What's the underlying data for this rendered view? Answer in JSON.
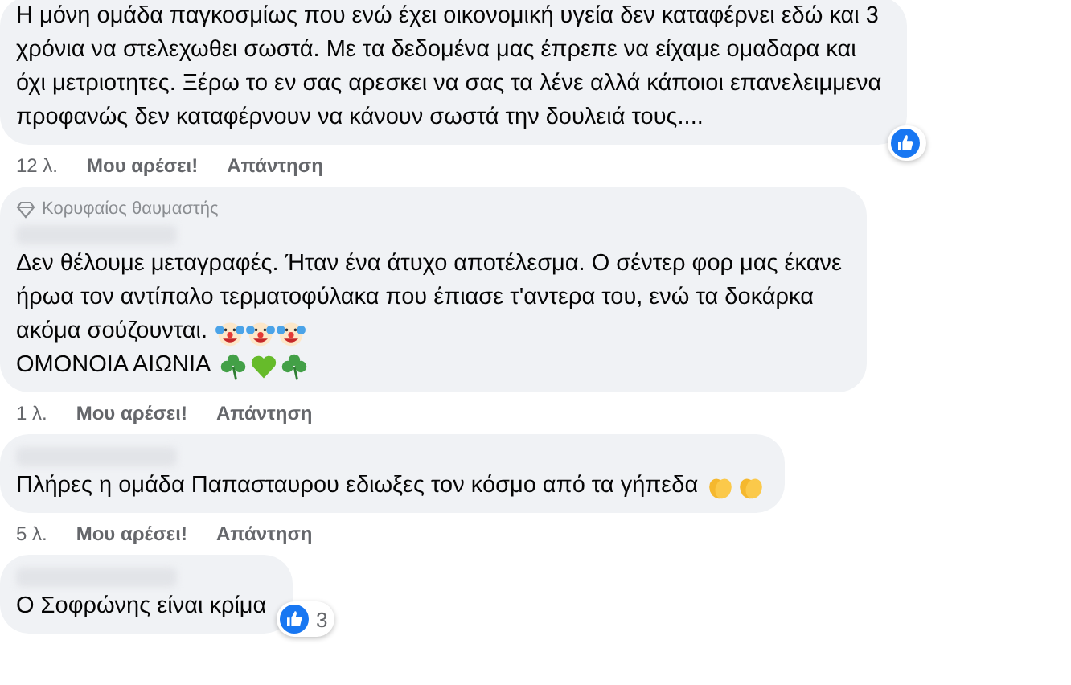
{
  "comments": [
    {
      "lines": [
        {
          "text": "Η μόνη ομάδα παγκοσμίως που ενώ έχει οικονομική υγεία δεν καταφέρνει εδώ και 3"
        },
        {
          "text": "χρόνια να στελεχωθει σωστά. Με τα δεδομένα μας έπρεπε να είχαμε ομαδαρα και"
        },
        {
          "text": "όχι μετριοτητες. Ξέρω το εν σας αρεσκει να σας τα λένε αλλά κάποιοι επανελειμμενα"
        },
        {
          "text": "προφανώς δεν καταφέρνουν να κάνουν σωστά την δουλειά τους...."
        }
      ],
      "reaction": {
        "kind": "like"
      },
      "time": "12 λ.",
      "like": "Μου αρέσει!",
      "reply": "Απάντηση"
    },
    {
      "badge": "Κορυφαίος θαυμαστής",
      "lines": [
        {
          "text": "Δεν θέλουμε μεταγραφές. Ήταν ένα άτυχο αποτέλεσμα. Ο σέντερ φορ μας έκανε"
        },
        {
          "text": "ήρωα τον αντίπαλο τερματοφύλακα που έπιασε τ'αντερα του, ενώ τα δοκάρκα"
        },
        {
          "text": "ακόμα σούζουνται.",
          "emojis": [
            {
              "kind": "clown"
            },
            {
              "kind": "clown"
            },
            {
              "kind": "clown"
            }
          ]
        },
        {
          "text": "ΟΜΟΝΟΙΑ ΑΙΩΝΙΑ",
          "emojis": [
            {
              "kind": "shamrock"
            },
            {
              "kind": "heart"
            },
            {
              "kind": "shamrock"
            }
          ]
        }
      ],
      "time": "1 λ.",
      "like": "Μου αρέσει!",
      "reply": "Απάντηση"
    },
    {
      "lines": [
        {
          "text": "Πλήρες η ομάδα Παπασταυρου εδιωξες τον κόσμο από τα γήπεδα",
          "emojis": [
            {
              "kind": "clap"
            },
            {
              "kind": "clap"
            }
          ]
        }
      ],
      "time": "5 λ.",
      "like": "Μου αρέσει!",
      "reply": "Απάντηση"
    },
    {
      "lines": [
        {
          "text": "Ο Σοφρώνης είναι κρίμα"
        }
      ],
      "reaction": {
        "kind": "like",
        "count": "3"
      }
    }
  ]
}
